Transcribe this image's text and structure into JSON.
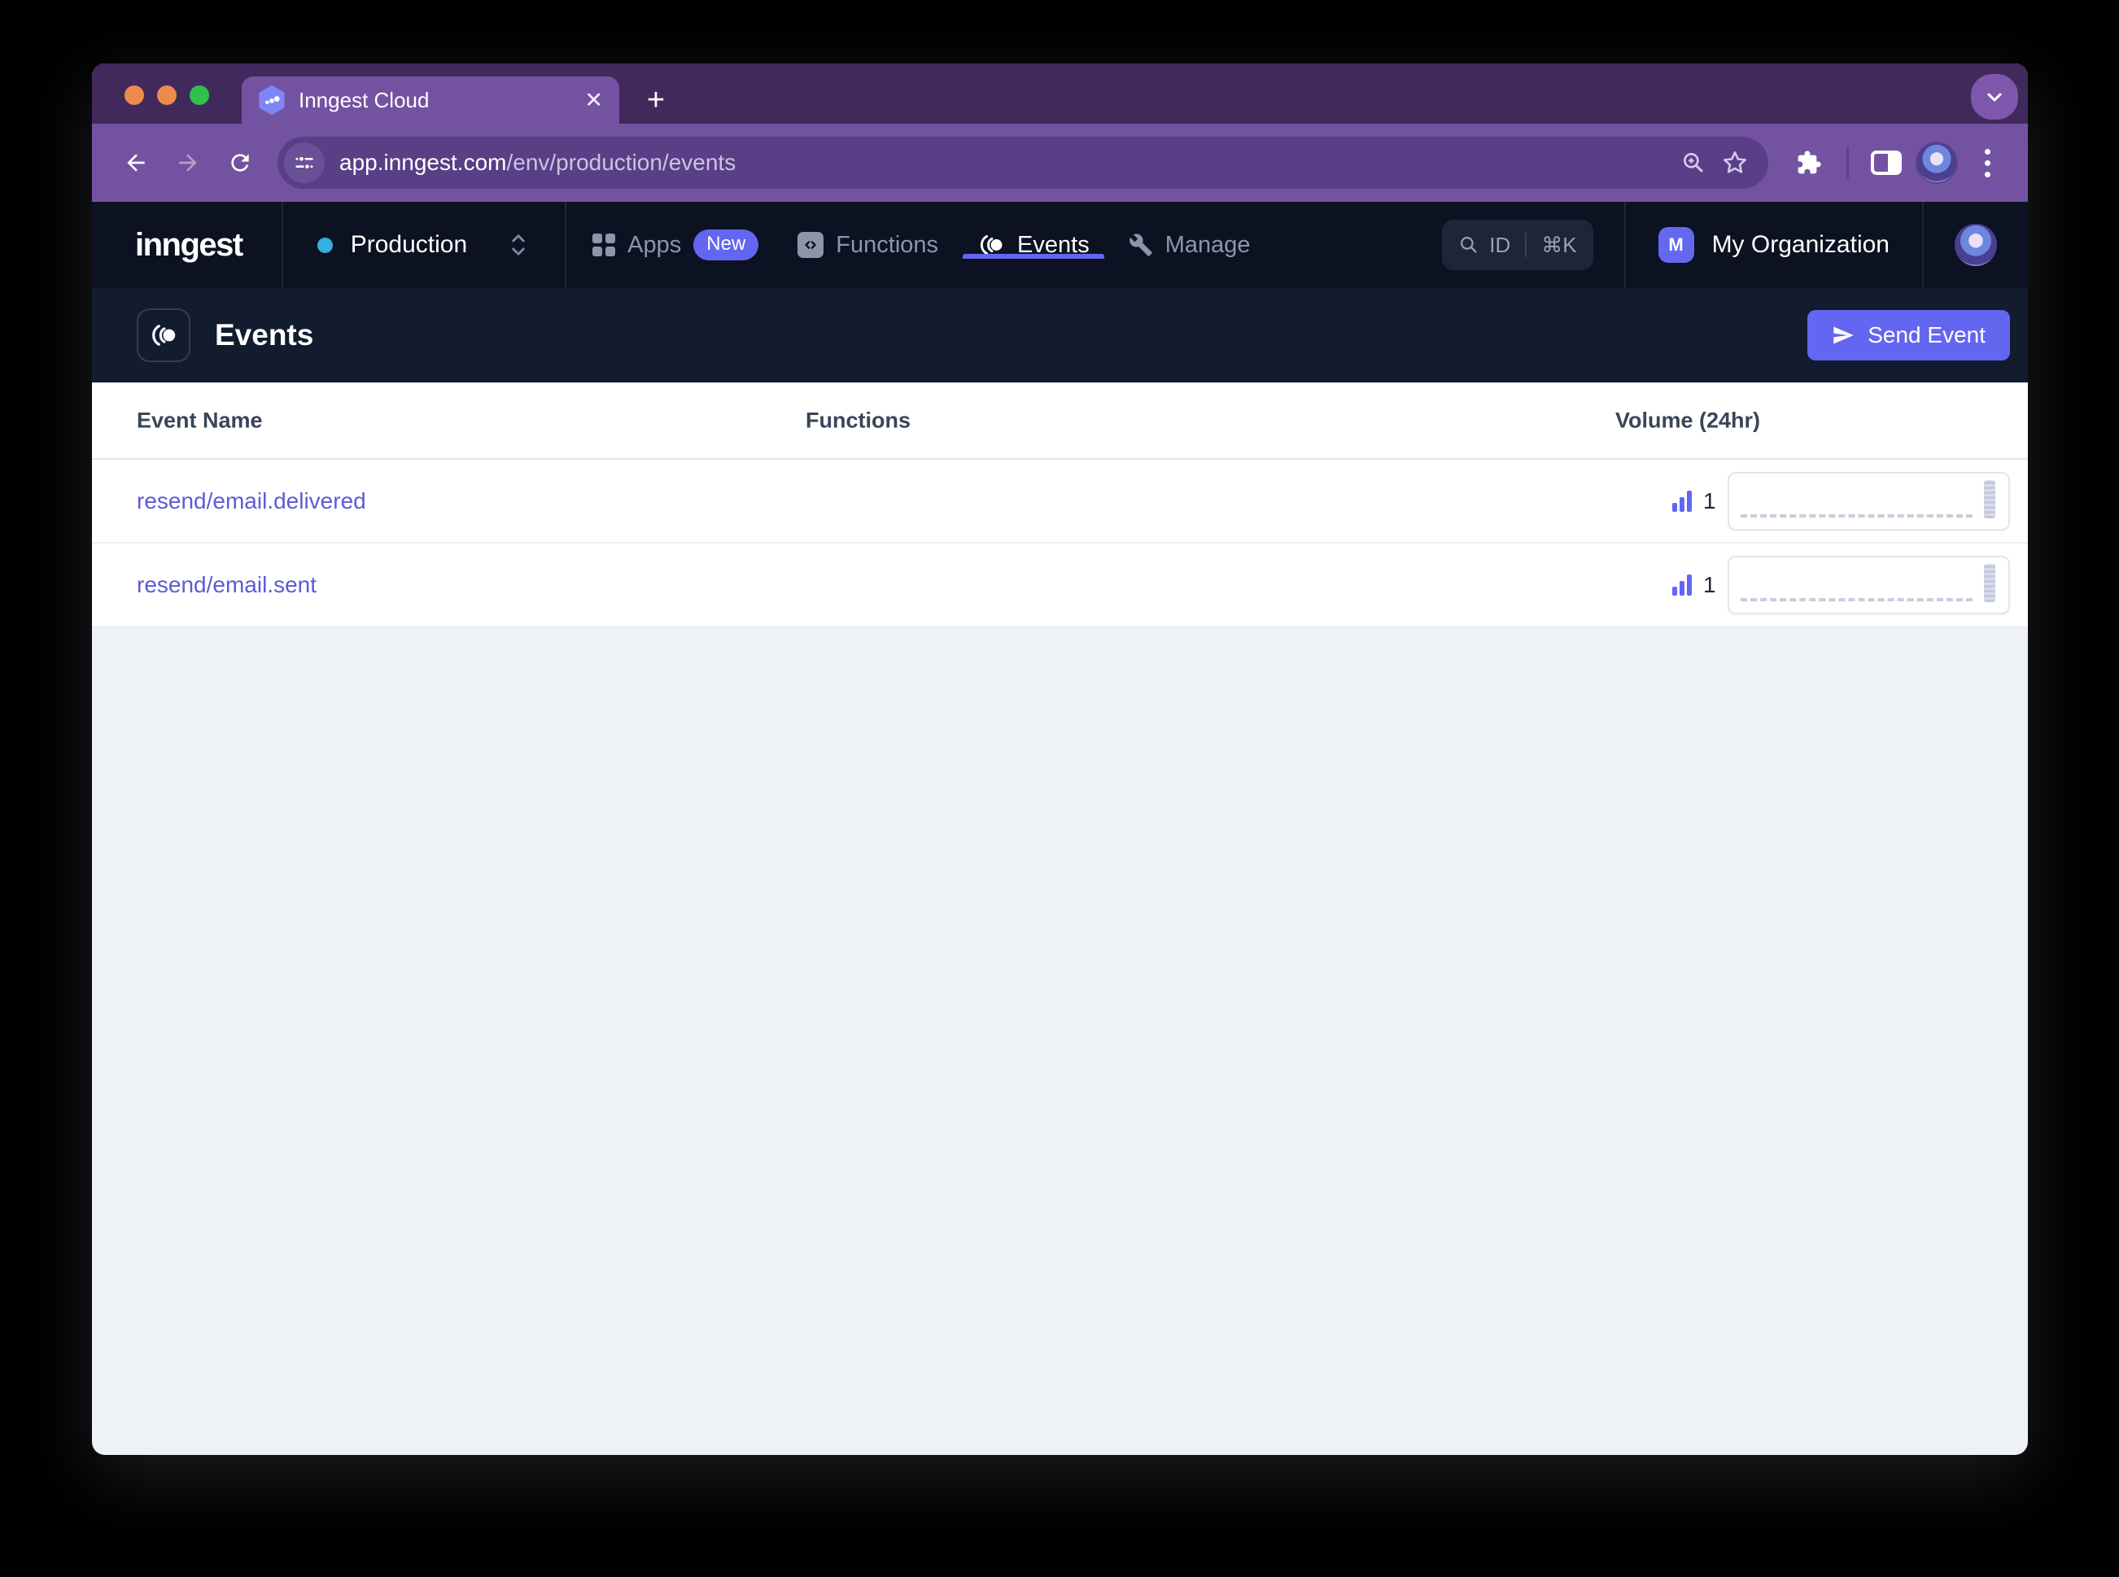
{
  "browser": {
    "tab_title": "Inngest Cloud",
    "new_tab": "+",
    "tab_close": "✕",
    "url": {
      "host": "app.inngest.com",
      "path": "/env/production/events"
    }
  },
  "nav": {
    "logo": "inngest",
    "environment": "Production",
    "apps_label": "Apps",
    "apps_badge": "New",
    "functions_label": "Functions",
    "events_label": "Events",
    "manage_label": "Manage",
    "search": {
      "id_label": "ID",
      "shortcut": "⌘K"
    },
    "org_badge": "M",
    "organization": "My Organization"
  },
  "page": {
    "title": "Events",
    "send_event_label": "Send Event"
  },
  "table": {
    "columns": [
      "Event Name",
      "Functions",
      "Volume (24hr)"
    ],
    "rows": [
      {
        "name": "resend/email.delivered",
        "volume": "1"
      },
      {
        "name": "resend/email.sent",
        "volume": "1"
      }
    ]
  },
  "colors": {
    "accent": "#6366F1",
    "link": "#5A5CD6",
    "tabstrip": "#42295C",
    "toolbar": "#7452A2",
    "urlpill": "#593F85",
    "nav_bg": "#0C1222",
    "pagehead_bg": "#131B2E",
    "main_bg": "#EEF1F6",
    "env_dot": "#38ADE3",
    "traffic_orange": "#ED8A4C",
    "traffic_green": "#2FC14E"
  }
}
